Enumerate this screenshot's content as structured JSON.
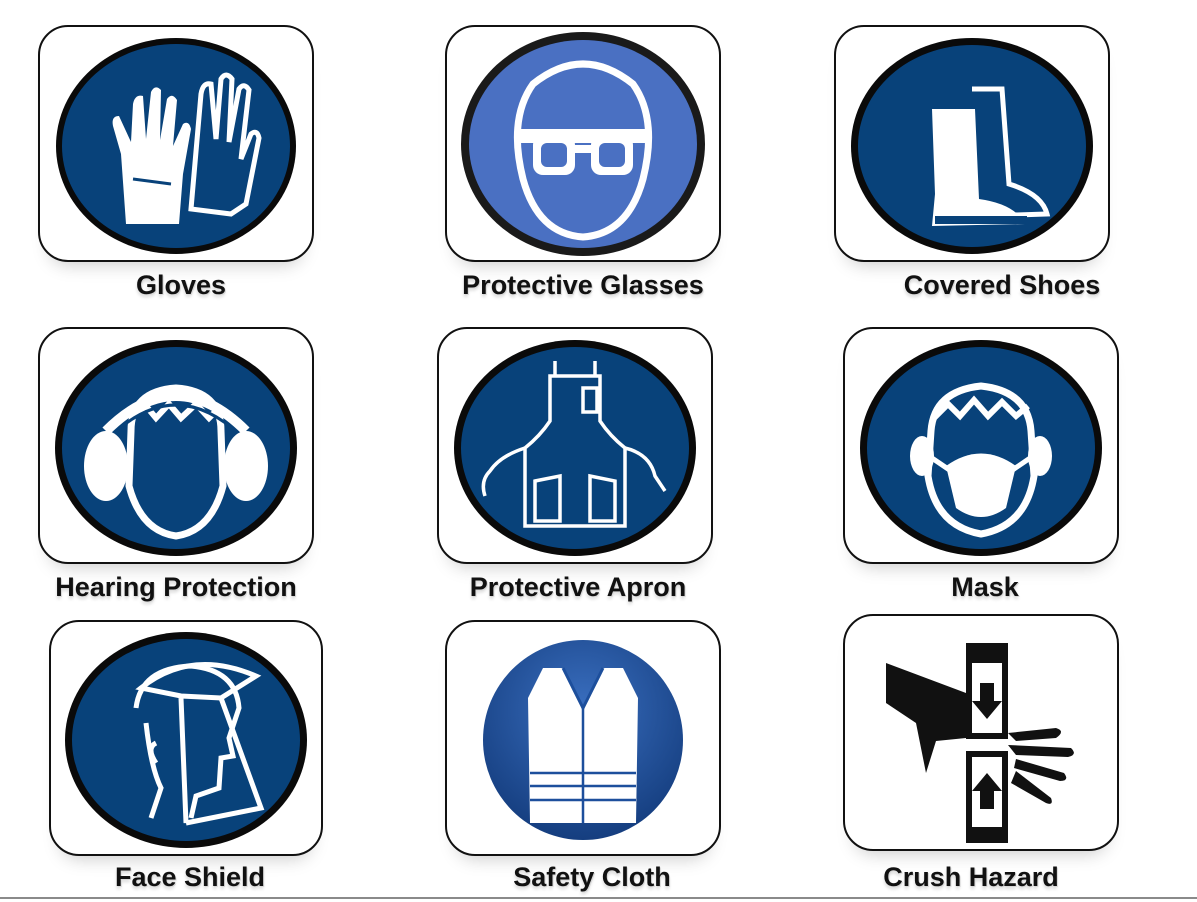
{
  "signs": [
    {
      "label": "Gloves",
      "icon": "gloves-icon"
    },
    {
      "label": "Protective Glasses",
      "icon": "goggles-icon"
    },
    {
      "label": "Covered Shoes",
      "icon": "boot-icon"
    },
    {
      "label": "Hearing Protection",
      "icon": "ear-defenders-icon"
    },
    {
      "label": "Protective Apron",
      "icon": "apron-icon"
    },
    {
      "label": "Mask",
      "icon": "mask-icon"
    },
    {
      "label": "Face Shield",
      "icon": "face-shield-icon"
    },
    {
      "label": "Safety Cloth",
      "icon": "safety-vest-icon"
    },
    {
      "label": "Crush Hazard",
      "icon": "crush-hazard-icon"
    }
  ],
  "colors": {
    "sign_blue": "#08427a",
    "glasses_blue": "#4a70c2",
    "vest_blue": "#1d4f9c",
    "symbol": "#ffffff",
    "hazard_black": "#111111"
  }
}
